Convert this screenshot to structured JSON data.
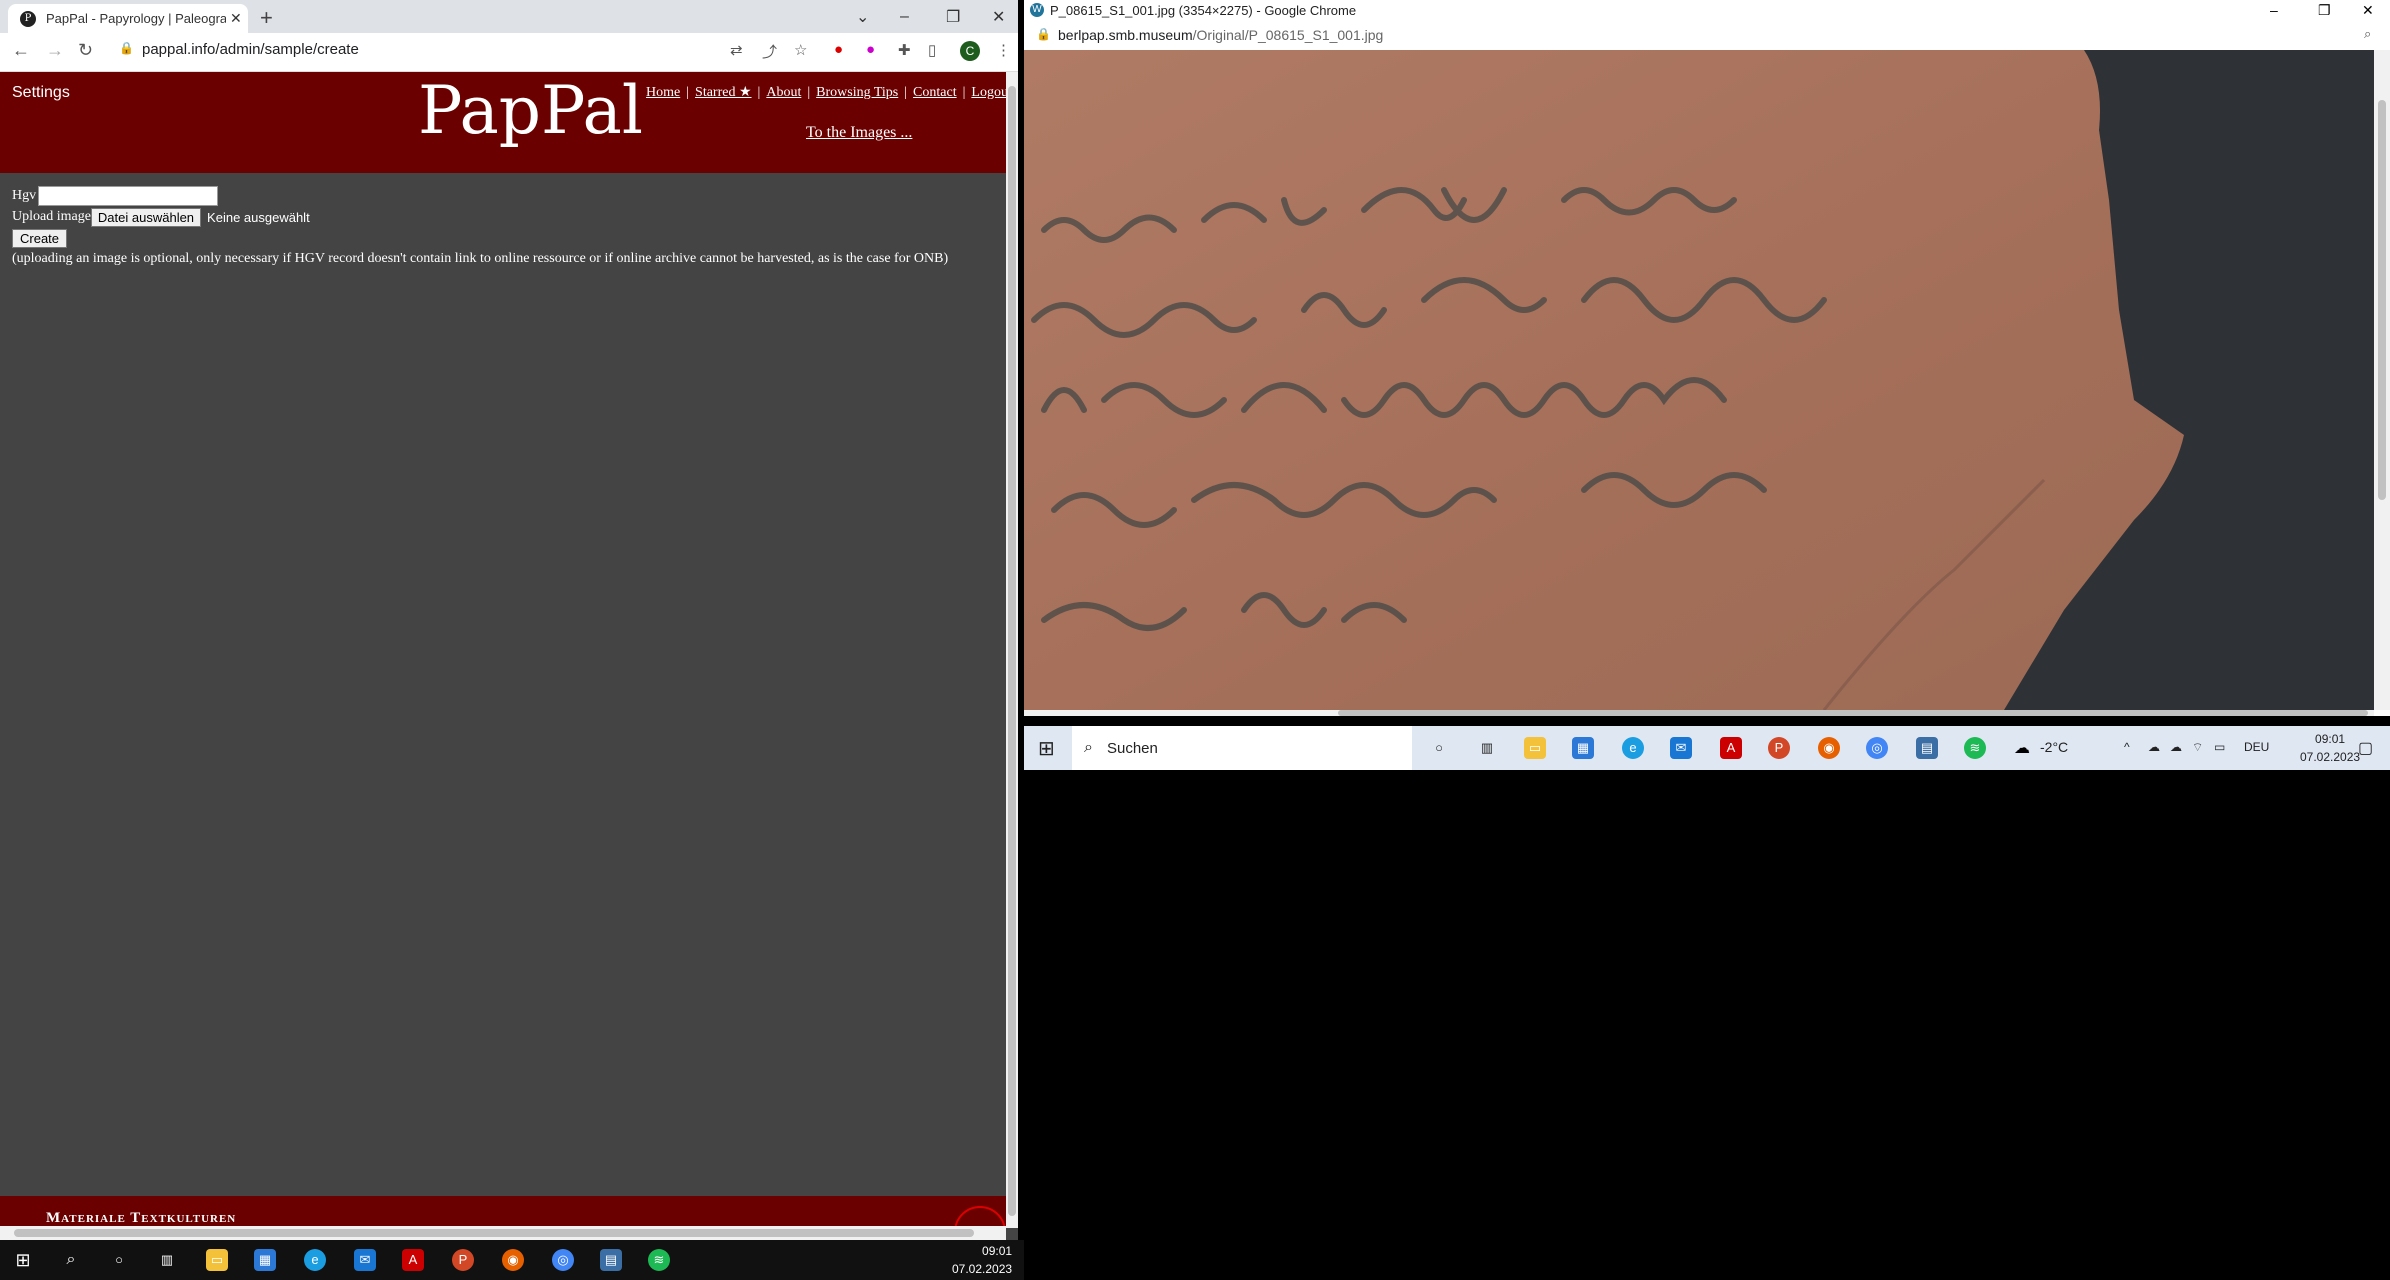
{
  "left_browser": {
    "tab_title": "PapPal - Papyrology | Paleograph",
    "url": "pappal.info/admin/sample/create"
  },
  "site": {
    "settings": "Settings",
    "brand": "PapPal",
    "nav": [
      "Home",
      "Starred ★",
      "About",
      "Browsing Tips",
      "Contact",
      "Logou"
    ],
    "to_images": "To the Images ...",
    "form": {
      "hgv_label": "Hgv",
      "hgv_value": "",
      "upload_label": "Upload image",
      "file_button": "Datei auswählen",
      "no_file": "Keine ausgewählt",
      "create_button": "Create",
      "note": "(uploading an image is optional, only necessary if HGV record doesn't contain link to online ressource or if online archive cannot be harvested, as is the case for ONB)"
    },
    "footer": "Materiale Textkulturen"
  },
  "right_browser": {
    "window_title": "P_08615_S1_001.jpg (3354×2275) - Google Chrome",
    "url_domain": "berlpap.smb.museum",
    "url_path": "/Original/P_08615_S1_001.jpg"
  },
  "right_taskbar": {
    "search_label": "Suchen",
    "weather": "-2°C",
    "lang": "DEU",
    "time": "09:01",
    "date": "07.02.2023"
  },
  "main_taskbar": {
    "time": "09:01",
    "date": "07.02.2023"
  }
}
